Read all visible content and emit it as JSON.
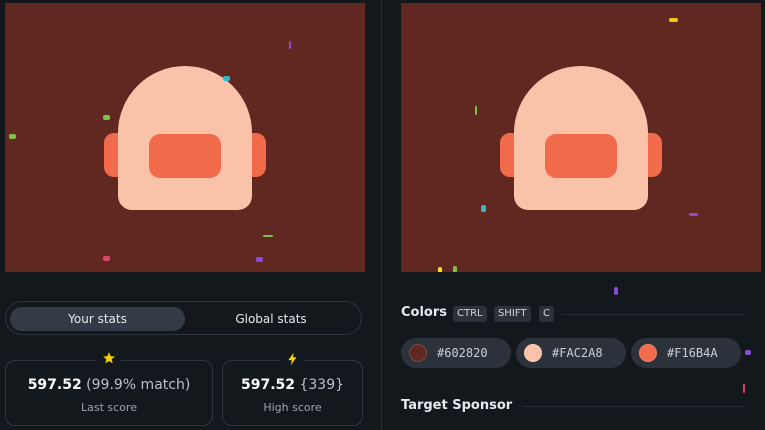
{
  "tabs": {
    "your_stats": "Your stats",
    "global_stats": "Global stats"
  },
  "last_score": {
    "icon": "star-icon",
    "value": "597.52",
    "detail": "(99.9% match)",
    "label": "Last score"
  },
  "high_score": {
    "icon": "lightning-icon",
    "value": "597.52",
    "detail": "{339}",
    "label": "High score"
  },
  "colors": {
    "title": "Colors",
    "shortcut_keys": [
      "CTRL",
      "SHIFT",
      "C"
    ],
    "swatches": [
      {
        "hex": "#602820"
      },
      {
        "hex": "#FAC2A8"
      },
      {
        "hex": "#F16B4A"
      }
    ]
  },
  "target_sponsor": {
    "title": "Target Sponsor"
  },
  "palette": {
    "background": "#602820",
    "skin": "#FAC2A8",
    "accent": "#F16B4A"
  }
}
